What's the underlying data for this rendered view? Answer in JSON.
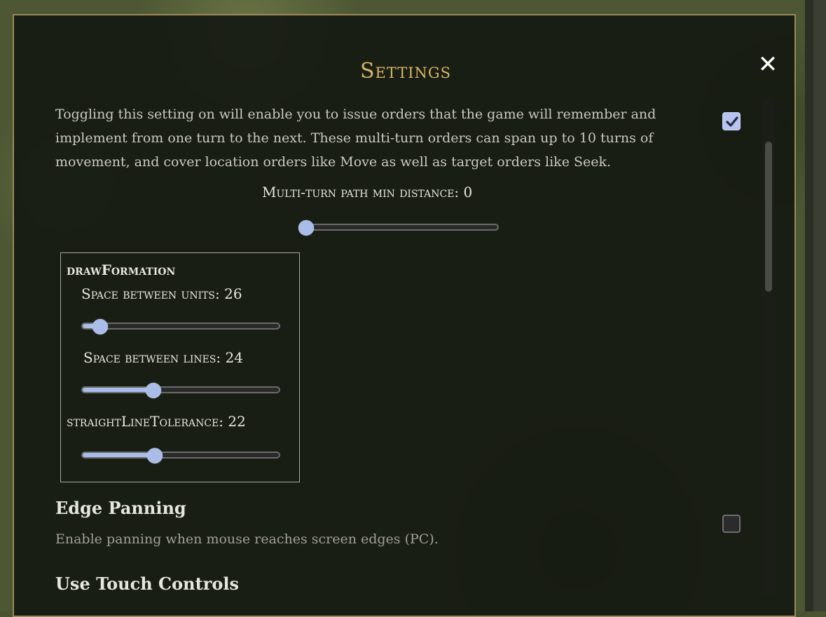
{
  "dialog": {
    "title": "Settings",
    "close_icon": "close-icon"
  },
  "multi_turn": {
    "description": "Toggling this setting on will enable you to issue orders that the game will remember and implement from one turn to the next. These multi-turn orders can span up to 10 turns of movement, and cover location orders like Move as well as target orders like Seek.",
    "enabled": true,
    "path_min_distance_label": "Multi-turn path min distance: 0",
    "path_min_distance_position": 0.0
  },
  "draw_formation": {
    "title": "drawFormation",
    "space_between_units_label": "Space between units: 26",
    "space_between_units_position": 0.06,
    "space_between_lines_label": "Space between lines: 24",
    "space_between_lines_position": 0.35,
    "straight_line_tolerance_label": "straightLineTolerance: 22",
    "straight_line_tolerance_position": 0.36
  },
  "edge_panning": {
    "title": "Edge Panning",
    "description": "Enable panning when mouse reaches screen edges (PC).",
    "enabled": false
  },
  "touch_controls": {
    "title": "Use Touch Controls"
  },
  "colors": {
    "accent": "#a9bde8",
    "title_gold": "#d8b565",
    "border_gold": "#9c8a5a"
  }
}
